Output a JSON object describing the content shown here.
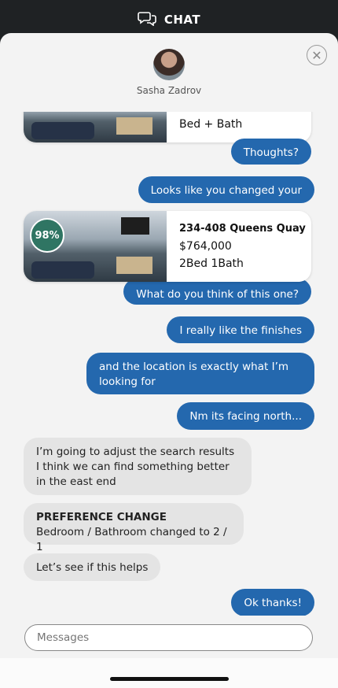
{
  "header": {
    "title": "CHAT"
  },
  "contact": {
    "name": "Sasha Zadrov"
  },
  "cards": [
    {
      "detail": "Bed + Bath"
    },
    {
      "match": "98%",
      "address": "234-408 Queens Quay",
      "price": "$764,000",
      "rooms": "2Bed  1Bath"
    }
  ],
  "messages": {
    "thoughts": "Thoughts?",
    "changed": "Looks like you changed your",
    "what_think": "What do you think of this one?",
    "finishes": "I really like the finishes",
    "location": "and the location is exactly what I’m looking for",
    "north": "Nm its facing north...",
    "adjust": "I’m going to adjust the search results I think we can find something better in the east end",
    "pref_title": "PREFERENCE CHANGE",
    "pref_detail": "Bedroom / Bathroom changed to 2 / 1",
    "see_helps": "Let’s see if this helps",
    "ok_thanks": "Ok thanks!"
  },
  "composer": {
    "placeholder": "Messages"
  },
  "colors": {
    "outgoing": "#2468ae",
    "incoming": "#e4e4e4",
    "badge": "#2f7563"
  }
}
